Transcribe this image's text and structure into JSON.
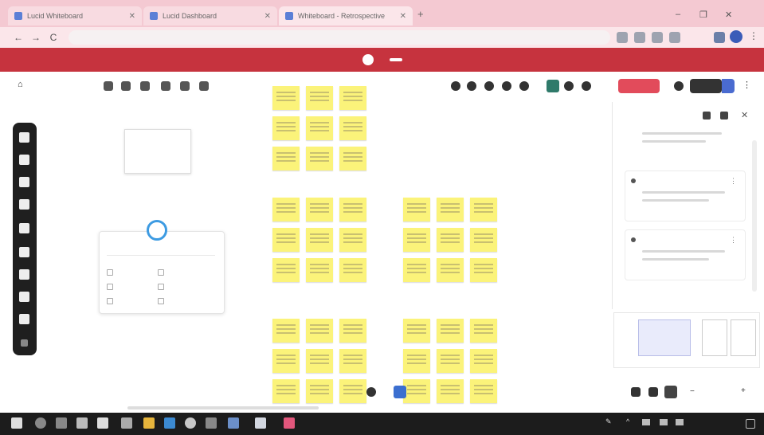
{
  "browser": {
    "tabs": [
      {
        "label": "Lucid Whiteboard"
      },
      {
        "label": "Lucid Dashboard"
      },
      {
        "label": "Whiteboard - Retrospective"
      }
    ],
    "new_tab": "+",
    "address": "",
    "nav": {
      "back": "←",
      "forward": "→",
      "reload": "C"
    },
    "window_buttons": [
      "–",
      "❐",
      "✕"
    ]
  },
  "banner": {
    "text": "",
    "button": ""
  },
  "app": {
    "board_title": "",
    "share_label": "",
    "assistant_card": {
      "title": ""
    },
    "side_panel": {
      "title": "",
      "cards": [
        {
          "title": ""
        },
        {
          "title": ""
        }
      ]
    },
    "zoom": ""
  },
  "canvas_groups": [
    {
      "title": ""
    },
    {
      "title": ""
    },
    {
      "title": ""
    },
    {
      "title": ""
    },
    {
      "title": ""
    }
  ],
  "colors": {
    "tabbar": "#f4c9d2",
    "banner": "#c6333e",
    "sticky": "#fbf37a",
    "share": "#e24b5b",
    "toolbar": "#1f1f1f"
  },
  "taskbar": {
    "clock_time": "",
    "clock_date": ""
  }
}
